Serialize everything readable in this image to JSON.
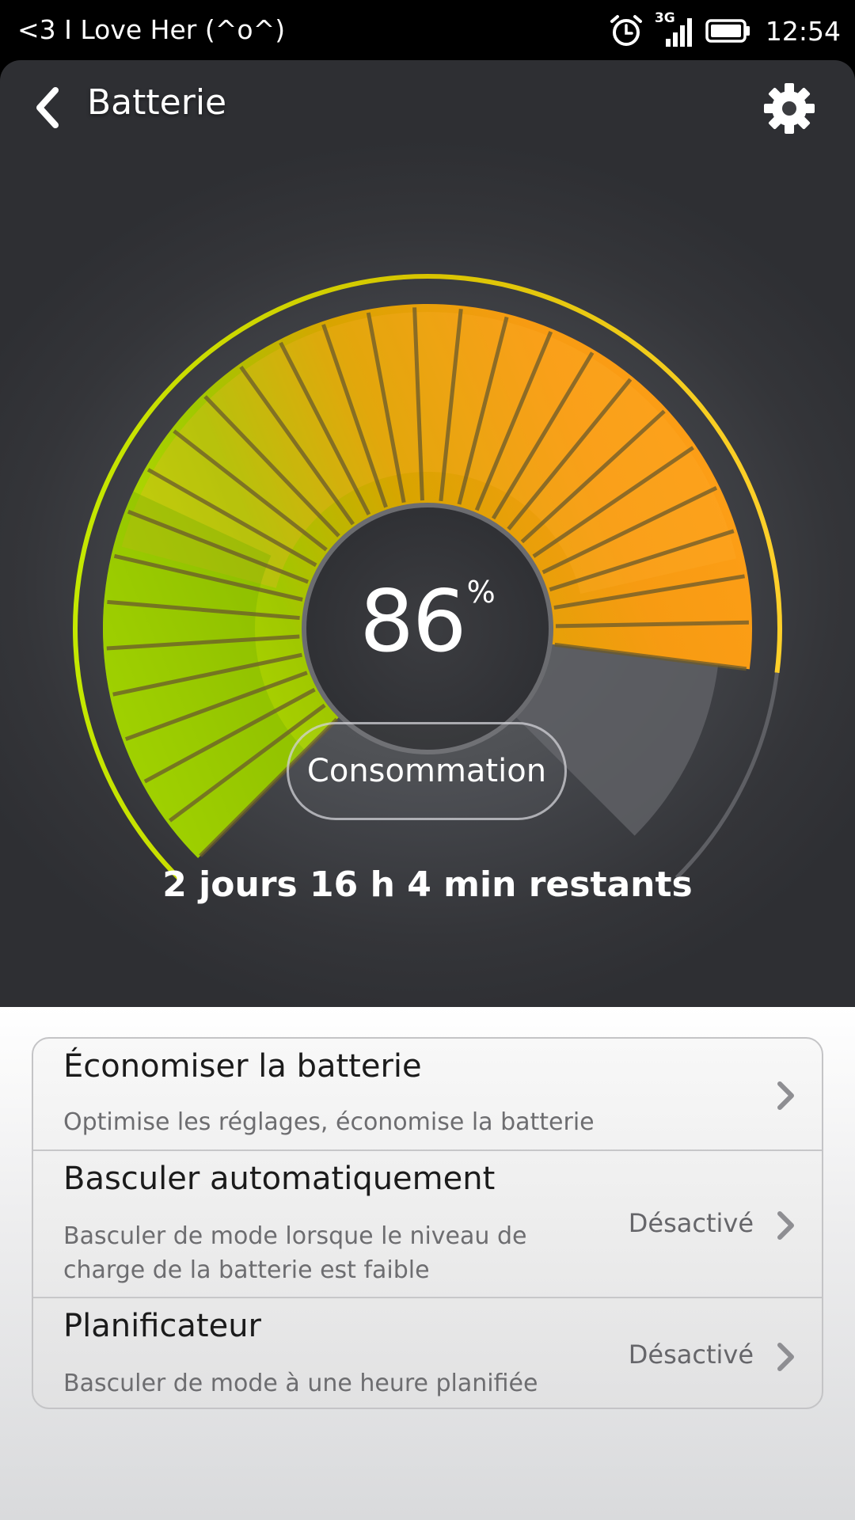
{
  "status_bar": {
    "carrier_text": "<3 I Love Her (^o^)",
    "network": "3G",
    "time": "12:54",
    "icons": [
      "alarm-icon",
      "signal-3g-icon",
      "battery-icon"
    ]
  },
  "header": {
    "title": "Batterie",
    "back_icon": "chevron-left-icon",
    "settings_icon": "gear-icon"
  },
  "battery": {
    "level_percent": 86,
    "value": "86",
    "unit": "%",
    "consumption_label": "Consommation",
    "remaining": "2 jours 16 h 4 min  restants"
  },
  "options": [
    {
      "title": "Économiser la batterie",
      "subtitle": "Optimise les réglages, économise la batterie",
      "status": ""
    },
    {
      "title": "Basculer automatiquement",
      "subtitle_line1": "Basculer de mode lorsque le niveau de",
      "subtitle_line2": "charge de la batterie est faible",
      "status": "Désactivé"
    },
    {
      "title": "Planificateur",
      "subtitle": "Basculer de mode à une heure planifiée",
      "status": "Désactivé"
    }
  ],
  "colors": {
    "gauge_green": "#a8d400",
    "gauge_orange": "#ff9a10",
    "background_dark": "#3a3b3f"
  }
}
